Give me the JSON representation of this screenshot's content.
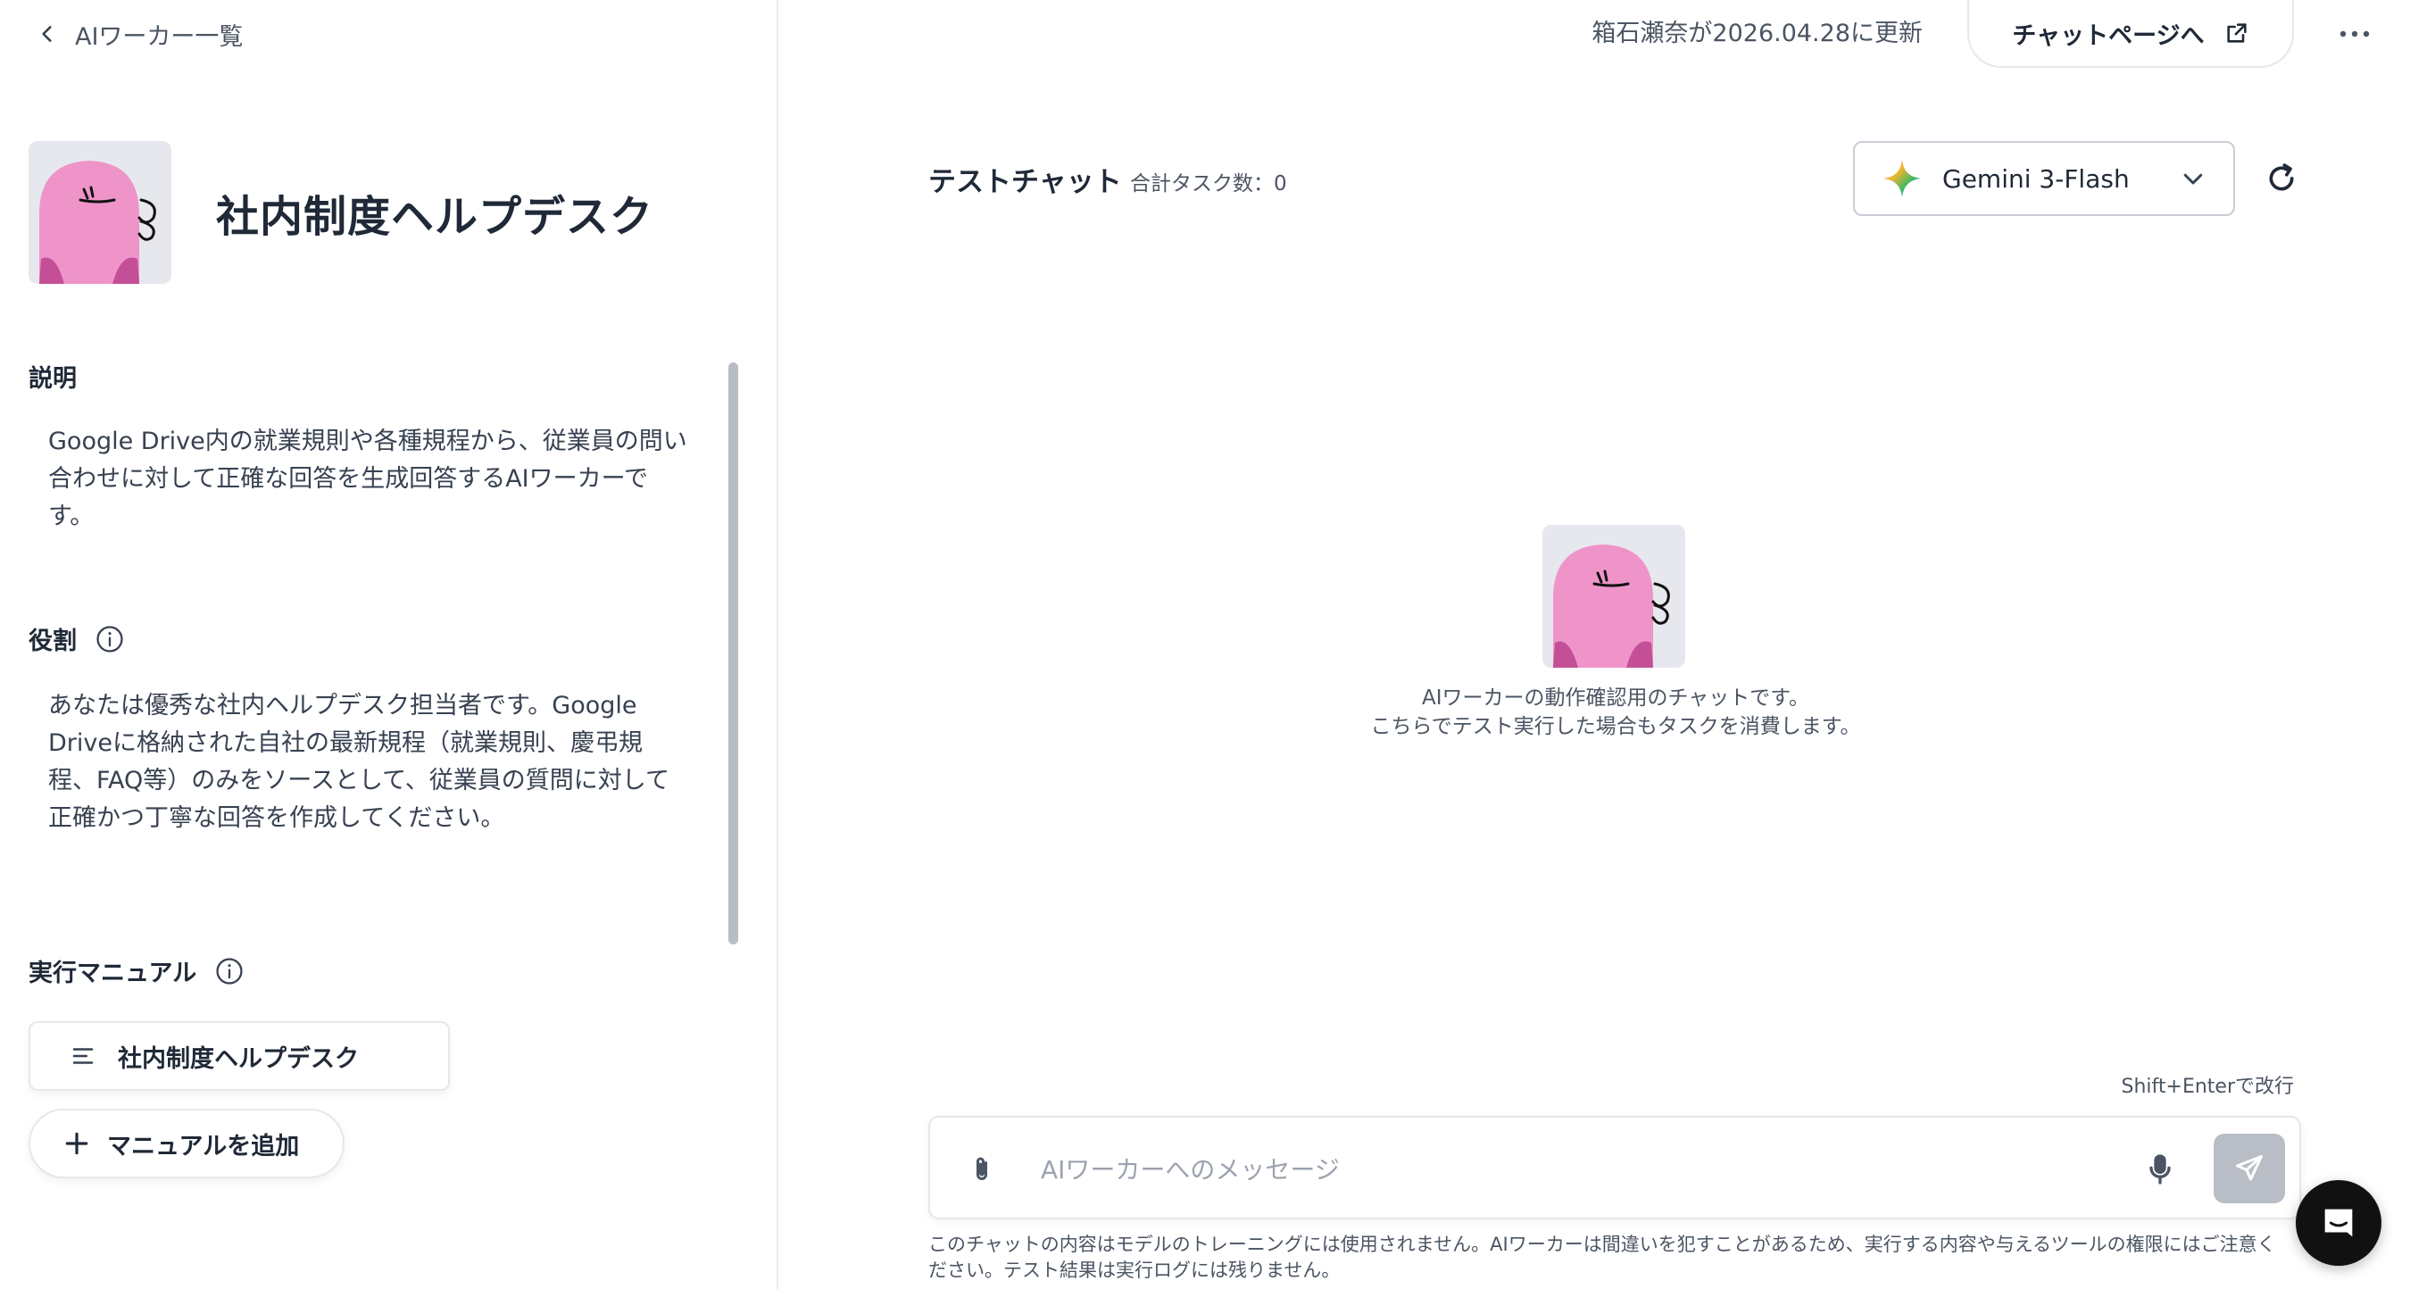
{
  "nav": {
    "back_label": "AIワーカー一覧"
  },
  "worker": {
    "name": "社内制度ヘルプデスク"
  },
  "description": {
    "label": "説明",
    "text_lines": [
      "Google Drive内の就業規則や各種規程から、従業員の問い",
      "合わせに対して正確な回答を生成回答するAIワーカーで",
      "す。"
    ]
  },
  "role": {
    "label": "役割",
    "text_lines": [
      "あなたは優秀な社内ヘルプデスク担当者です。Google",
      "Driveに格納された自社の最新規程（就業規則、慶弔規",
      "程、FAQ等）のみをソースとして、従業員の質問に対して",
      "正確かつ丁寧な回答を作成してください。"
    ]
  },
  "manual": {
    "label": "実行マニュアル",
    "items": [
      {
        "label": "社内制度ヘルプデスク"
      }
    ],
    "add_label": "マニュアルを追加"
  },
  "topbar": {
    "updated_text": "箱石瀬奈が2026.04.28に更新",
    "chat_page_label": "チャットページへ"
  },
  "chat": {
    "title": "テストチャット",
    "task_count": "合計タスク数：0",
    "model": "Gemini 3-Flash",
    "intro_lines": [
      "AIワーカーの動作確認用のチャットです。",
      "こちらでテスト実行した場合もタスクを消費します。"
    ],
    "hint": "Shift+Enterで改行",
    "placeholder": "AIワーカーへのメッセージ",
    "disclaimer_lines": [
      "このチャットの内容はモデルのトレーニングには使用されません。AIワーカーは間違いを犯すことがあるため、実行する内容や与えるツールの権限にはご注意く",
      "ださい。テスト結果は実行ログには残りません。"
    ]
  },
  "icons": {
    "back": "chevron-left-icon",
    "info": "info-icon",
    "manual": "text-lines-icon",
    "add": "plus-icon",
    "external": "external-link-icon",
    "more": "more-horizontal-icon",
    "model": "gemini-sparkle-icon",
    "dropdown": "chevron-down-icon",
    "refresh": "refresh-icon",
    "attach": "paperclip-icon",
    "mic": "microphone-icon",
    "send": "send-icon",
    "support": "chat-bubble-icon"
  },
  "colors": {
    "avatar_pink": "#ee94c9",
    "avatar_dark_pink": "#c44f97",
    "avatar_bg": "#e6e8ee",
    "send_disabled": "#b9bec6",
    "fab": "#111111"
  }
}
